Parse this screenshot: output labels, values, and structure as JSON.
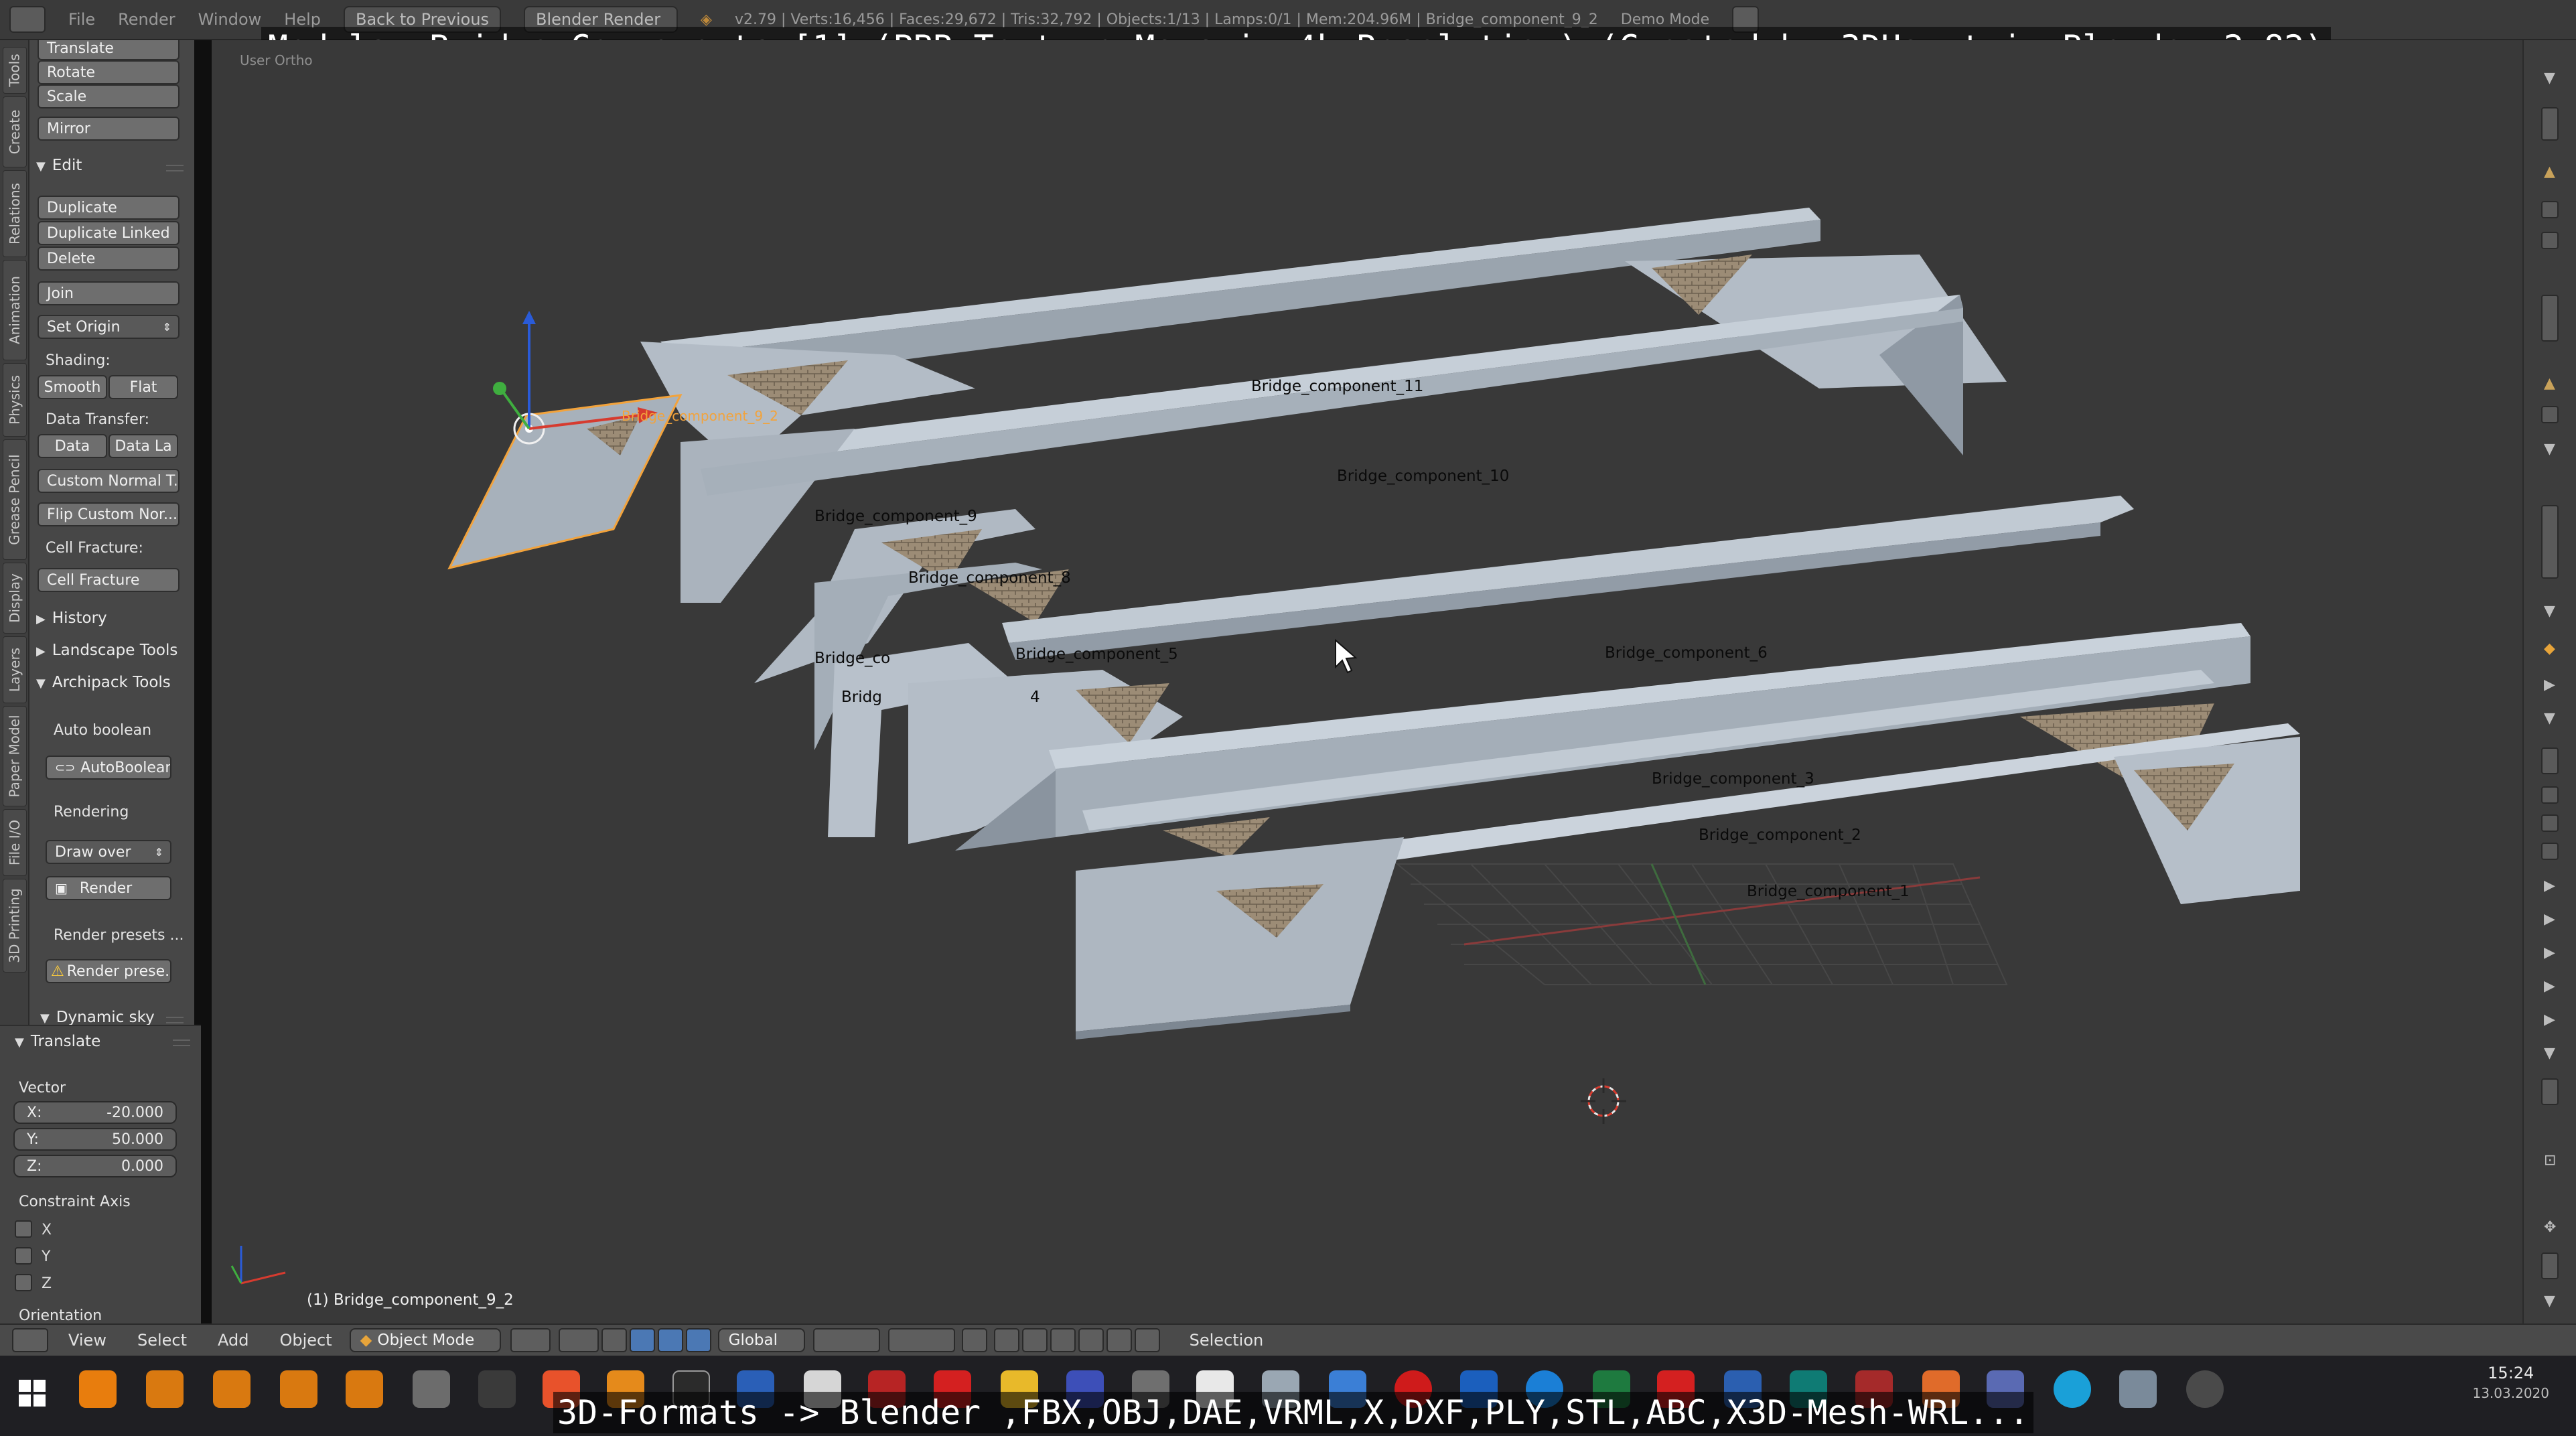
{
  "window": {
    "menus": [
      "File",
      "Render",
      "Window",
      "Help"
    ],
    "back_button": "Back to Previous",
    "render_engine": "Blender Render",
    "stats": "v2.79 | Verts:16,456 | Faces:29,672 | Tris:32,792 | Objects:1/13 | Lamps:0/1 | Mem:204.96M | Bridge_component_9_2",
    "mode_label": "Demo Mode"
  },
  "overlay": {
    "title": "Modular Bridge Components [1] (PBR Texture Maps in 4k Resolution) (Created by 3DHaupt in Blender-2.82)",
    "bottom": "3D-Formats -> Blender ,FBX,OBJ,DAE,VRML,X,DXF,PLY,STL,ABC,X3D-Mesh-WRL..."
  },
  "vertical_tabs": [
    "Tools",
    "Create",
    "Relations",
    "Animation",
    "Physics",
    "Grease Pencil",
    "Display",
    "Layers",
    "Paper Model",
    "File I/O",
    "3D Printing"
  ],
  "toolshelf": {
    "transform_buttons": [
      "Translate",
      "Rotate",
      "Scale",
      "Mirror"
    ],
    "edit_header": "Edit",
    "edit_buttons": [
      "Duplicate",
      "Duplicate Linked",
      "Delete",
      "Join"
    ],
    "set_origin": "Set Origin",
    "shading_label": "Shading:",
    "shading_buttons": [
      "Smooth",
      "Flat"
    ],
    "data_transfer_label": "Data Transfer:",
    "data_transfer_buttons": [
      "Data",
      "Data La"
    ],
    "custom_normal": "Custom Normal T...",
    "flip_custom": "Flip Custom Nor...",
    "cell_fracture_label": "Cell Fracture:",
    "cell_fracture_button": "Cell Fracture",
    "history_header": "History",
    "landscape_header": "Landscape Tools",
    "archipack_header": "Archipack Tools",
    "auto_boolean_label": "Auto boolean",
    "auto_boolean_button": "AutoBoolean",
    "rendering_label": "Rendering",
    "draw_over": "Draw over",
    "render_button": "Render",
    "render_presets_label": "Render presets ...",
    "render_presets_button": "Render prese...",
    "dynamic_sky_header": "Dynamic sky"
  },
  "operator": {
    "header": "Translate",
    "vector_label": "Vector",
    "x_label": "X:",
    "x_value": "-20.000",
    "y_label": "Y:",
    "y_value": "50.000",
    "z_label": "Z:",
    "z_value": "0.000",
    "constraint_label": "Constraint Axis",
    "axes": [
      "X",
      "Y",
      "Z"
    ],
    "orientation_label": "Orientation"
  },
  "viewport": {
    "view_label": "User Ortho",
    "active_object": "(1) Bridge_component_9_2",
    "selected_label": "Bridge_component_9_2",
    "object_labels": [
      "Bridge_component_11",
      "Bridge_component_10",
      "Bridge_component_9",
      "Bridge_component_8",
      "Bridge_co",
      "Bridge_component_5",
      "Bridg",
      "4",
      "Bridge_component_6",
      "Bridge_component_3",
      "Bridge_component_2",
      "Bridge_component_1"
    ]
  },
  "view_header": {
    "menus": [
      "View",
      "Select",
      "Add",
      "Object"
    ],
    "mode": "Object Mode",
    "orientation": "Global",
    "status": "Selection"
  },
  "taskbar": {
    "time": "15:24",
    "date": "13.03.2020"
  },
  "colors": {
    "viewport_bg": "#393939",
    "bridge_light": "#b9c2cc",
    "bridge_dark": "#8f99a4",
    "bridge_shadow": "#6f7882",
    "selection_outline": "#f2a33c",
    "accent": "#4b78b4"
  }
}
